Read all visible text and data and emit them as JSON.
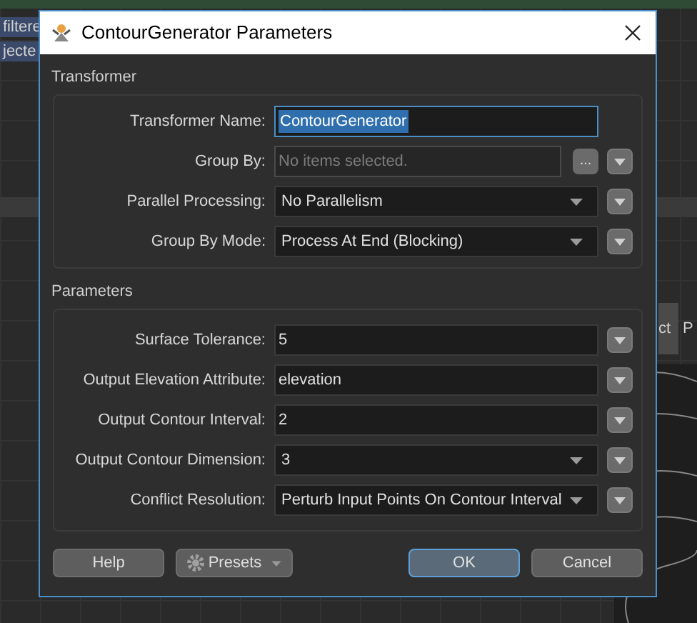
{
  "canvas": {
    "nodes": [
      "filtere",
      "jecte"
    ],
    "right_labels": [
      "ct",
      "P"
    ]
  },
  "dialog": {
    "title": "ContourGenerator Parameters",
    "sections": [
      {
        "title": "Transformer",
        "rows": [
          {
            "label": "Transformer Name:",
            "kind": "name",
            "value": "ContourGenerator",
            "has_menu": false
          },
          {
            "label": "Group By:",
            "kind": "list",
            "placeholder": "No items selected.",
            "browse": "...",
            "has_menu": true
          },
          {
            "label": "Parallel Processing:",
            "kind": "choice",
            "value": "No Parallelism",
            "has_menu": true
          },
          {
            "label": "Group By Mode:",
            "kind": "choice",
            "value": "Process At End (Blocking)",
            "has_menu": true
          }
        ]
      },
      {
        "title": "Parameters",
        "rows": [
          {
            "label": "Surface Tolerance:",
            "kind": "text",
            "value": "5",
            "has_menu": true
          },
          {
            "label": "Output Elevation Attribute:",
            "kind": "text",
            "value": "elevation",
            "has_menu": true
          },
          {
            "label": "Output Contour Interval:",
            "kind": "text",
            "value": "2",
            "has_menu": true
          },
          {
            "label": "Output Contour Dimension:",
            "kind": "choice",
            "value": "3",
            "has_menu": true
          },
          {
            "label": "Conflict Resolution:",
            "kind": "choice",
            "value": "Perturb Input Points On Contour Interval",
            "has_menu": true
          }
        ]
      }
    ],
    "buttons": [
      {
        "label": "Help",
        "kind": "plain",
        "default": false
      },
      {
        "label": "Presets",
        "kind": "presets",
        "default": false
      },
      {
        "label": "OK",
        "kind": "plain",
        "default": true
      },
      {
        "label": "Cancel",
        "kind": "plain",
        "default": false
      }
    ]
  }
}
